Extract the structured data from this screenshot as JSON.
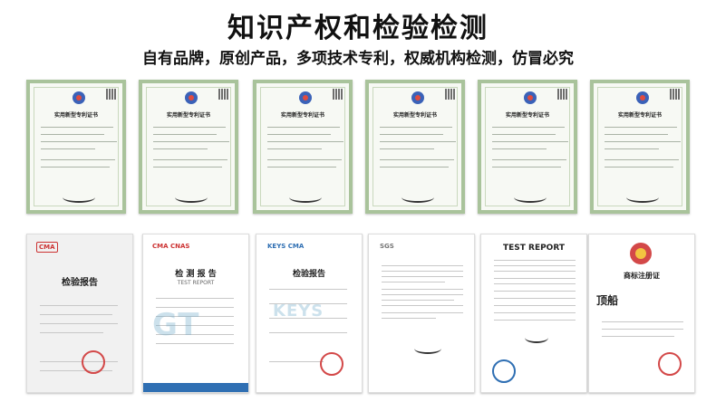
{
  "header": {
    "title": "知识产权和检验检测",
    "subtitle": "自有品牌，原创产品，多项技术专利，权威机构检测，仿冒必究"
  },
  "certificates": [
    {
      "title": "实用新型专利证书"
    },
    {
      "title": "实用新型专利证书"
    },
    {
      "title": "实用新型专利证书"
    },
    {
      "title": "实用新型专利证书"
    },
    {
      "title": "实用新型专利证书"
    },
    {
      "title": "实用新型专利证书"
    }
  ],
  "reports": [
    {
      "logo": "CMA",
      "title": "检验报告"
    },
    {
      "logo": "CMA  CNAS",
      "title": "检 测 报 告",
      "subtitle": "TEST REPORT",
      "watermark": "GT"
    },
    {
      "logo": "KEYS  CMA",
      "title": "检验报告",
      "watermark": "KEYS"
    },
    {
      "logo": "SGS",
      "title": ""
    },
    {
      "logo": "TEST REPORT",
      "title": "TEST REPORT"
    },
    {
      "logo": "商标注册证",
      "title": "商标注册证",
      "subtitle": "顶船"
    }
  ],
  "colors": {
    "cert_border": "#a9c39b",
    "stamp_red": "#d34848",
    "title_text": "#111111"
  }
}
